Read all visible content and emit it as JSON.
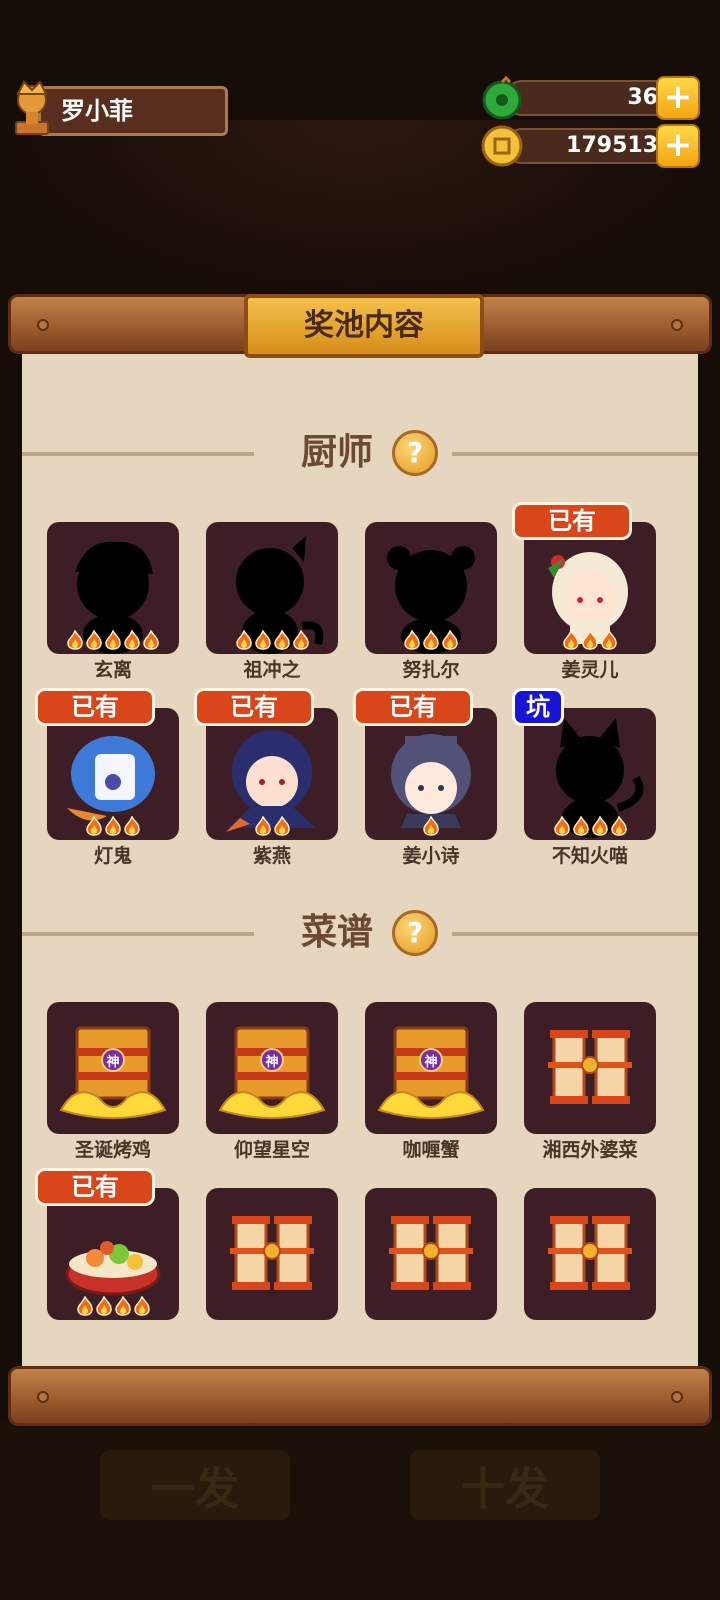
{
  "player": {
    "name": "罗小菲"
  },
  "currencies": [
    {
      "icon": "jade-icon",
      "value": "36",
      "plus": "+"
    },
    {
      "icon": "coin-icon",
      "value": "179513",
      "plus": "+"
    }
  ],
  "panel": {
    "title": "奖池内容"
  },
  "sections": {
    "chefs": {
      "label": "厨师",
      "help": "?"
    },
    "recipes": {
      "label": "菜谱",
      "help": "?"
    }
  },
  "badges": {
    "owned": "已有",
    "pit": "坑"
  },
  "chefs": [
    {
      "name": "玄离",
      "stars": 5,
      "owned": false
    },
    {
      "name": "祖冲之",
      "stars": 4,
      "owned": false
    },
    {
      "name": "努扎尔",
      "stars": 3,
      "owned": false
    },
    {
      "name": "姜灵儿",
      "stars": 3,
      "owned": true
    },
    {
      "name": "灯鬼",
      "stars": 3,
      "owned": true
    },
    {
      "name": "紫燕",
      "stars": 2,
      "owned": true
    },
    {
      "name": "姜小诗",
      "stars": 1,
      "owned": true
    },
    {
      "name": "不知火喵",
      "stars": 4,
      "pit": true
    }
  ],
  "recipes": [
    {
      "name": "圣诞烤鸡",
      "kind": "divine"
    },
    {
      "name": "仰望星空",
      "kind": "divine"
    },
    {
      "name": "咖喱蟹",
      "kind": "divine"
    },
    {
      "name": "湘西外婆菜",
      "kind": "scroll"
    },
    {
      "name": "",
      "kind": "dish",
      "owned": true,
      "stars": 4
    },
    {
      "name": "",
      "kind": "scroll"
    },
    {
      "name": "",
      "kind": "scroll"
    },
    {
      "name": "",
      "kind": "scroll"
    }
  ],
  "divine_mark": "神",
  "ghost_buttons": {
    "single": "一发",
    "ten": "十发"
  },
  "colors": {
    "badge_owned": "#d9461a",
    "badge_pit": "#1a14d4",
    "card_bg": "#3e1e26",
    "paper": "#e6d6bf"
  }
}
